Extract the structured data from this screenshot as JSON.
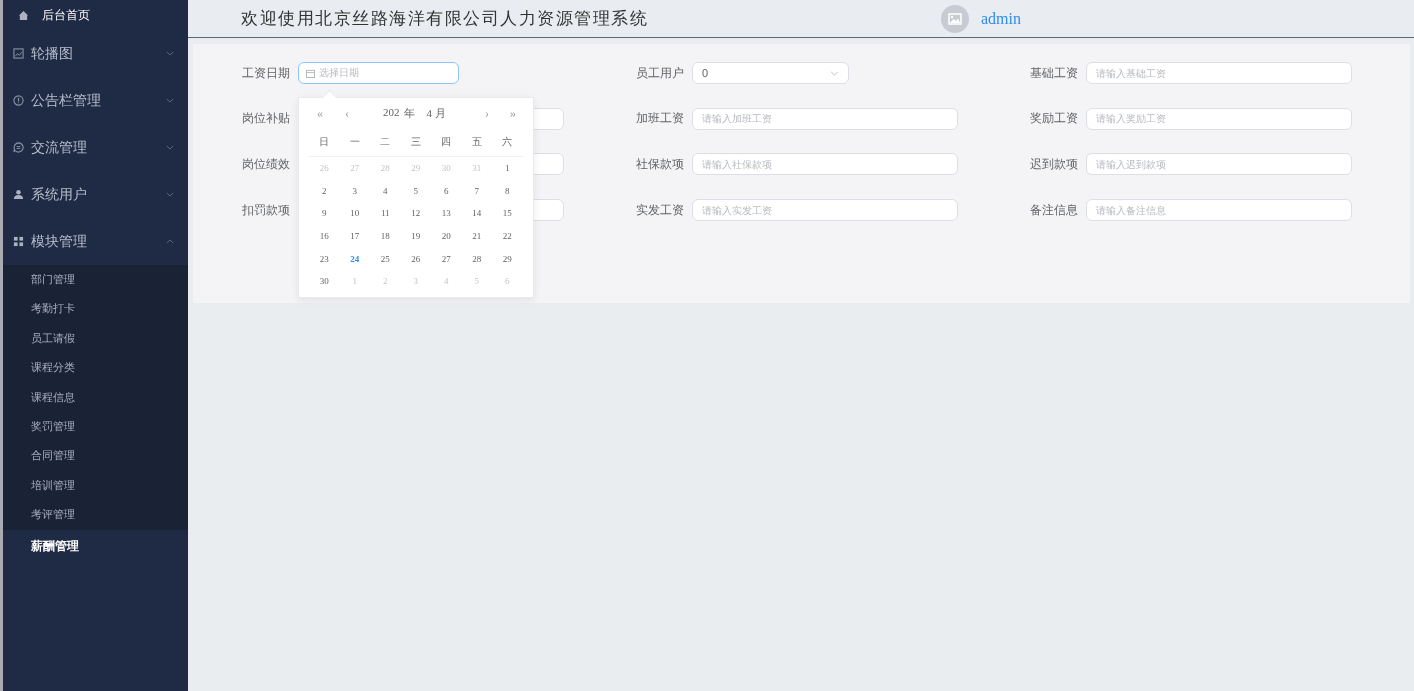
{
  "sidebar": {
    "home": {
      "label": "后台首页"
    },
    "groups": [
      {
        "label": "轮播图",
        "kind": "image",
        "expanded": false
      },
      {
        "label": "公告栏管理",
        "kind": "alert",
        "expanded": false
      },
      {
        "label": "交流管理",
        "kind": "chat",
        "expanded": false
      },
      {
        "label": "系统用户",
        "kind": "user",
        "expanded": false
      },
      {
        "label": "模块管理",
        "kind": "grid",
        "expanded": true,
        "children": [
          {
            "label": "部门管理",
            "selected": false
          },
          {
            "label": "考勤打卡",
            "selected": false
          },
          {
            "label": "员工请假",
            "selected": false
          },
          {
            "label": "课程分类",
            "selected": false
          },
          {
            "label": "课程信息",
            "selected": false
          },
          {
            "label": "奖罚管理",
            "selected": false
          },
          {
            "label": "合同管理",
            "selected": false
          },
          {
            "label": "培训管理",
            "selected": false
          },
          {
            "label": "考评管理",
            "selected": false
          },
          {
            "label": "薪酬管理",
            "selected": true
          }
        ]
      }
    ]
  },
  "header": {
    "title": "欢迎使用北京丝路海洋有限公司人力资源管理系统",
    "user": "admin"
  },
  "form": {
    "columns": [
      [
        {
          "label": "工资日期",
          "kind": "date",
          "placeholder": "选择日期",
          "focused": true
        },
        {
          "label": "岗位补贴",
          "kind": "input"
        },
        {
          "label": "岗位绩效",
          "kind": "input"
        },
        {
          "label": "扣罚款项",
          "kind": "input"
        }
      ],
      [
        {
          "label": "员工用户",
          "kind": "select",
          "value": "0"
        },
        {
          "label": "加班工资",
          "kind": "input",
          "placeholder": "请输入加班工资"
        },
        {
          "label": "社保款项",
          "kind": "input",
          "placeholder": "请输入社保款项"
        },
        {
          "label": "实发工资",
          "kind": "input",
          "placeholder": "请输入实发工资"
        }
      ],
      [
        {
          "label": "基础工资",
          "kind": "input",
          "placeholder": "请输入基础工资"
        },
        {
          "label": "奖励工资",
          "kind": "input",
          "placeholder": "请输入奖励工资"
        },
        {
          "label": "迟到款项",
          "kind": "input",
          "placeholder": "请输入迟到款项"
        },
        {
          "label": "备注信息",
          "kind": "input",
          "placeholder": "请输入备注信息"
        }
      ]
    ]
  },
  "calendar": {
    "prev_year": "«",
    "prev_month": "‹",
    "year": "202",
    "year_unit": "年",
    "month": "4 月",
    "next_month": "›",
    "next_year": "»",
    "weekdays": [
      "日",
      "一",
      "二",
      "三",
      "四",
      "五",
      "六"
    ],
    "days": [
      {
        "d": "26",
        "muted": true,
        "today": false
      },
      {
        "d": "27",
        "muted": true,
        "today": false
      },
      {
        "d": "28",
        "muted": true,
        "today": false
      },
      {
        "d": "29",
        "muted": true,
        "today": false
      },
      {
        "d": "30",
        "muted": true,
        "today": false
      },
      {
        "d": "31",
        "muted": true,
        "today": false
      },
      {
        "d": "1",
        "muted": false,
        "today": false
      },
      {
        "d": "2",
        "muted": false,
        "today": false
      },
      {
        "d": "3",
        "muted": false,
        "today": false
      },
      {
        "d": "4",
        "muted": false,
        "today": false
      },
      {
        "d": "5",
        "muted": false,
        "today": false
      },
      {
        "d": "6",
        "muted": false,
        "today": false
      },
      {
        "d": "7",
        "muted": false,
        "today": false
      },
      {
        "d": "8",
        "muted": false,
        "today": false
      },
      {
        "d": "9",
        "muted": false,
        "today": false
      },
      {
        "d": "10",
        "muted": false,
        "today": false
      },
      {
        "d": "11",
        "muted": false,
        "today": false
      },
      {
        "d": "12",
        "muted": false,
        "today": false
      },
      {
        "d": "13",
        "muted": false,
        "today": false
      },
      {
        "d": "14",
        "muted": false,
        "today": false
      },
      {
        "d": "15",
        "muted": false,
        "today": false
      },
      {
        "d": "16",
        "muted": false,
        "today": false
      },
      {
        "d": "17",
        "muted": false,
        "today": false
      },
      {
        "d": "18",
        "muted": false,
        "today": false
      },
      {
        "d": "19",
        "muted": false,
        "today": false
      },
      {
        "d": "20",
        "muted": false,
        "today": false
      },
      {
        "d": "21",
        "muted": false,
        "today": false
      },
      {
        "d": "22",
        "muted": false,
        "today": false
      },
      {
        "d": "23",
        "muted": false,
        "today": false
      },
      {
        "d": "24",
        "muted": false,
        "today": true
      },
      {
        "d": "25",
        "muted": false,
        "today": false
      },
      {
        "d": "26",
        "muted": false,
        "today": false
      },
      {
        "d": "27",
        "muted": false,
        "today": false
      },
      {
        "d": "28",
        "muted": false,
        "today": false
      },
      {
        "d": "29",
        "muted": false,
        "today": false
      },
      {
        "d": "30",
        "muted": false,
        "today": false
      },
      {
        "d": "1",
        "muted": true,
        "today": false
      },
      {
        "d": "2",
        "muted": true,
        "today": false
      },
      {
        "d": "3",
        "muted": true,
        "today": false
      },
      {
        "d": "4",
        "muted": true,
        "today": false
      },
      {
        "d": "5",
        "muted": true,
        "today": false
      },
      {
        "d": "6",
        "muted": true,
        "today": false
      }
    ]
  }
}
